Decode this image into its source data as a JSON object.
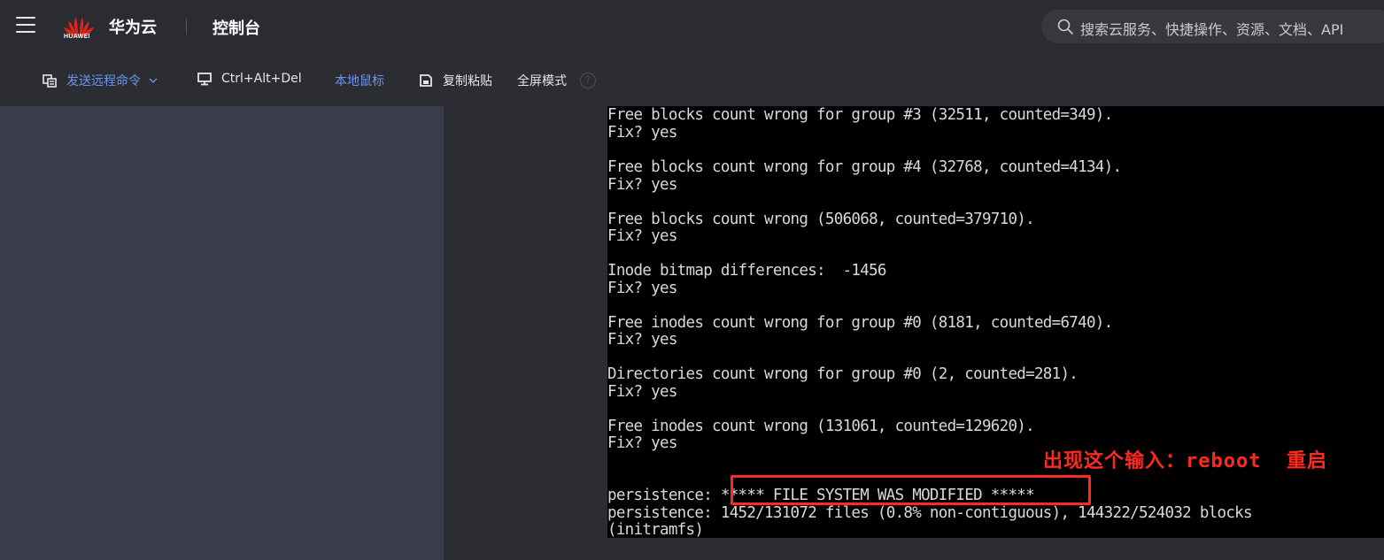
{
  "header": {
    "logo_text": "HUAWEI",
    "brand": "华为云",
    "console_title": "控制台",
    "search_placeholder": "搜索云服务、快捷操作、资源、文档、API"
  },
  "toolbar": {
    "send_command": "发送远程命令",
    "ctrl_alt_del": "Ctrl+Alt+Del",
    "local_mouse": "本地鼠标",
    "copy_paste": "复制粘贴",
    "fullscreen": "全屏模式",
    "help": "?"
  },
  "terminal": {
    "lines": [
      "Free blocks count wrong for group #3 (32511, counted=349).",
      "Fix? yes",
      "",
      "Free blocks count wrong for group #4 (32768, counted=4134).",
      "Fix? yes",
      "",
      "Free blocks count wrong (506068, counted=379710).",
      "Fix? yes",
      "",
      "Inode bitmap differences:  -1456",
      "Fix? yes",
      "",
      "Free inodes count wrong for group #0 (8181, counted=6740).",
      "Fix? yes",
      "",
      "Directories count wrong for group #0 (2, counted=281).",
      "Fix? yes",
      "",
      "Free inodes count wrong (131061, counted=129620).",
      "Fix? yes",
      "",
      "",
      "persistence: ***** FILE SYSTEM WAS MODIFIED *****",
      "persistence: 1452/131072 files (0.8% non-contiguous), 144322/524032 blocks",
      "(initramfs)"
    ],
    "annotation": "出现这个输入：reboot  重启"
  },
  "colors": {
    "accent": "#6b95f5",
    "annotation": "#ff2a1f",
    "terminal_bg": "#000000",
    "sidebar_bg": "#393c4a"
  }
}
